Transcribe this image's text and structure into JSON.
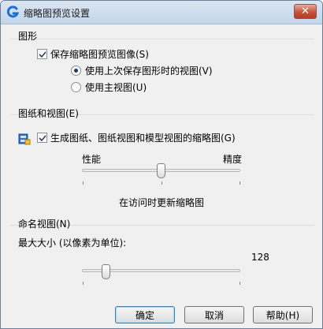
{
  "window": {
    "title": "缩略图预览设置",
    "close_label": "✕"
  },
  "graphics": {
    "title": "图形",
    "save_preview": {
      "label": "保存缩略图预览图像(S)",
      "checked": true
    },
    "options": [
      {
        "label": "使用上次保存图形时的视图(V)",
        "selected": true
      },
      {
        "label": "使用主视图(U)",
        "selected": false
      }
    ]
  },
  "sheets": {
    "title": "图纸和视图(E)",
    "generate": {
      "label": "生成图纸、图纸视图和模型视图的缩略图(G)",
      "checked": true
    },
    "performance_label": "性能",
    "accuracy_label": "精度",
    "slider_level": 0.5,
    "status_text": "在访问时更新缩略图"
  },
  "named_views": {
    "title": "命名视图(N)",
    "max_size_label": "最大大小 (以像素为单位):",
    "value": "128",
    "slider_level": 0.15
  },
  "buttons": {
    "ok": "确定",
    "cancel": "取消",
    "help": "帮助(H)"
  },
  "colors": {
    "title_bar": "#c4d5ea",
    "close_button": "#c8523b",
    "accent": "#3c7fb1"
  }
}
